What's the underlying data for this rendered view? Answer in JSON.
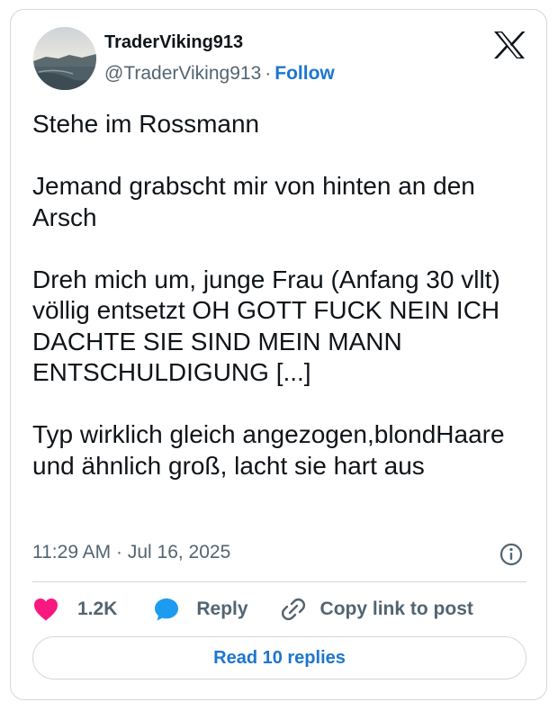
{
  "author": {
    "display_name": "TraderViking913",
    "handle": "@TraderViking913",
    "separator": "·",
    "follow_label": "Follow",
    "avatar": "landscape-photo"
  },
  "brand_icon": "x-logo-icon",
  "tweet": {
    "paragraphs": [
      "Stehe im Rossmann",
      "Jemand grabscht mir von hinten an den Arsch",
      "Dreh mich um, junge Frau (Anfang 30 vllt) völlig entsetzt OH GOTT FUCK NEIN ICH DACHTE SIE SIND MEIN MANN ENTSCHULDIGUNG [...]",
      "Typ wirklich gleich angezogen,blondHaare und ähnlich groß, lacht sie hart aus"
    ],
    "timestamp": "11:29 AM · Jul 16, 2025"
  },
  "actions": {
    "like_count": "1.2K",
    "reply_label": "Reply",
    "copy_link_label": "Copy link to post"
  },
  "read_replies_label": "Read 10 replies",
  "colors": {
    "heart": "#f91880",
    "reply_bubble": "#1d9bf0",
    "link_blue": "#1d76cf",
    "secondary_text": "#536471",
    "border": "#cfd9de"
  }
}
